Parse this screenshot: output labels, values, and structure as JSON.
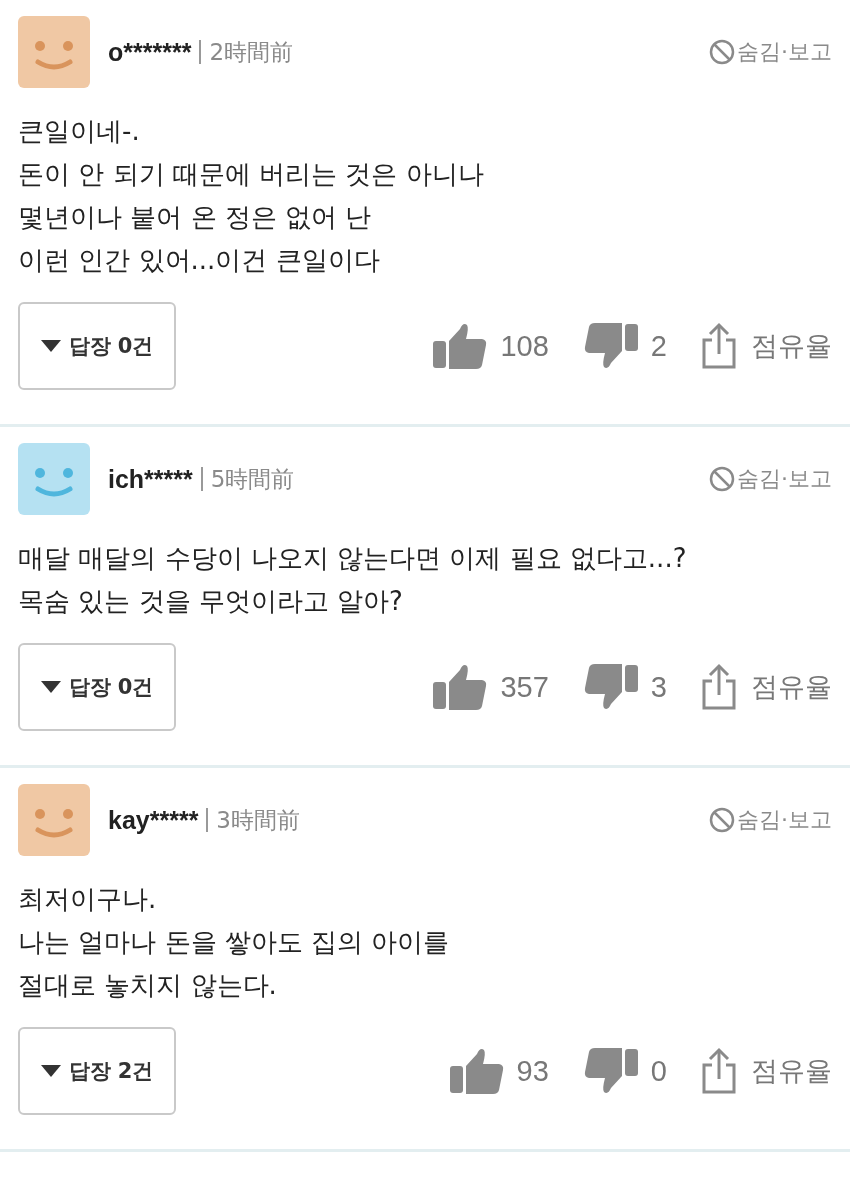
{
  "comments": [
    {
      "color": "#f0c8a4",
      "user": "o*******",
      "time": "2時間前",
      "hide_report": "숨김·보고",
      "text": "큰일이네-.\n돈이 안 되기 때문에 버리는 것은 아니나\n몇년이나 붙어 온 정은 없어 난\n이런 인간 있어...이건 큰일이다",
      "replies": "답장 0건",
      "likes": "108",
      "dislikes": "2",
      "share": "점유율"
    },
    {
      "color": "#b5e1f2",
      "user": "ich*****",
      "time": "5時間前",
      "hide_report": "숨김·보고",
      "text": "매달 매달의 수당이 나오지 않는다면 이제 필요 없다고...?\n목숨 있는 것을 무엇이라고 알아?",
      "replies": "답장 0건",
      "likes": "357",
      "dislikes": "3",
      "share": "점유율"
    },
    {
      "color": "#f0c8a4",
      "user": "kay*****",
      "time": "3時間前",
      "hide_report": "숨김·보고",
      "text": "최저이구나.\n나는 얼마나 돈을 쌓아도 집의 아이를\n절대로 놓치지 않는다.",
      "replies": "답장 2건",
      "likes": "93",
      "dislikes": "0",
      "share": "점유율"
    }
  ]
}
